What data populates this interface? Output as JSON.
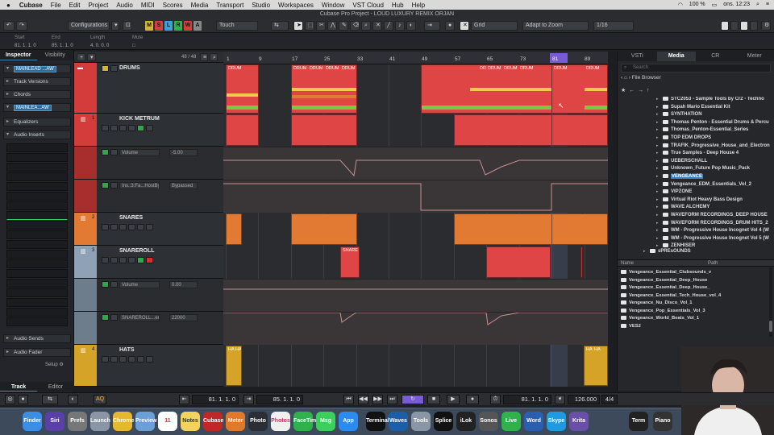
{
  "menubar": {
    "app": "Cubase",
    "items": [
      "File",
      "Edit",
      "Project",
      "Audio",
      "MIDI",
      "Scores",
      "Media",
      "Transport",
      "Studio",
      "Workspaces",
      "Window",
      "VST Cloud",
      "Hub",
      "Help"
    ],
    "battery": "100 %",
    "clock": "ons. 12:23"
  },
  "window_title": "Cubase Pro Project - LOUD LUXURY REMIX ORJAN",
  "toolbar": {
    "configurations": "Configurations",
    "mode_buttons": [
      "M",
      "S",
      "L",
      "R",
      "W",
      "A"
    ],
    "touch": "Touch",
    "grid": "Grid",
    "adapt": "Adapt to Zoom",
    "quantize": "1/16"
  },
  "infoline": {
    "labels": [
      "Start",
      "End",
      "Length",
      "Mute"
    ],
    "values": [
      "81. 1. 1.  0",
      "85. 1. 1.  0",
      "4. 0. 0.  0",
      "□"
    ]
  },
  "inspector": {
    "tabs": [
      "Inspector",
      "Visibility"
    ],
    "track_name": "MAINLEAD ...AW",
    "rows": [
      "Track Versions",
      "Chords",
      "Equalizers",
      "Audio Inserts"
    ],
    "track_name2": "MAINLEA...AW",
    "bottom_rows": [
      "Audio Sends",
      "Audio Fader"
    ],
    "setup": "Setup",
    "bottom_tabs": [
      "Track",
      "Editor"
    ]
  },
  "tracklist": {
    "count": "48 / 48",
    "tracks": [
      {
        "name": "DRUMS",
        "color": "#d43b3b",
        "num": ""
      },
      {
        "name": "KICK METRUM",
        "color": "#d43b3b",
        "num": "1"
      },
      {
        "name": "SNARES",
        "color": "#e27a34",
        "num": "2"
      },
      {
        "name": "SNAREROLL",
        "color": "#8fa1b5",
        "num": "3"
      },
      {
        "name": "HATS",
        "color": "#d4a327",
        "num": "4"
      }
    ],
    "lanes": [
      {
        "label": "Volume",
        "value": "-5.00"
      },
      {
        "label": "Ins.:3:Fa...HostBypass",
        "value": "Bypassed"
      },
      {
        "label": "Volume",
        "value": "0.00"
      },
      {
        "label": "SNAREROLL...erCutoff",
        "value": "22000"
      }
    ]
  },
  "ruler": {
    "bars": [
      "1",
      "9",
      "17",
      "25",
      "33",
      "41",
      "49",
      "57",
      "65",
      "73",
      "81",
      "89"
    ]
  },
  "events": {
    "drum_label": "DRUM",
    "dr_label": "DR",
    "snare_label": "SNARE",
    "hat_label": "HA"
  },
  "mediabay": {
    "tabs": [
      "VSTi",
      "Media",
      "CR",
      "Meter"
    ],
    "search_placeholder": "Search",
    "file_browser": "File Browser",
    "folders": [
      "STC2053 - Sample Tools by Cr2 - Techno",
      "Supah Mario Essential Kit",
      "SYNTHATION",
      "Thomas Penton - Essential Drums & Percu",
      "Thomas_Penton-Essential_Series",
      "TOP EDM DROPS",
      "TRAFIK_Progressive_House_and_Electron",
      "True Samples - Deep House 4",
      "UEBERSCHALL",
      "Unknown_Future Pop Music_Pack",
      "VENGEANCE",
      "Vengeance_EDM_Essentials_Vol_2",
      "VIPZONE",
      "Virtual Riot Heavy Bass Design",
      "WAVE ALCHEMY",
      "WAVEFORM RECORDINGS_DEEP HOUSE",
      "WAVEFORM RECORDINGS_DRUM HITS_2",
      "WM - Progressive House Incognet Vol 4 (W",
      "WM - Progressive House Incognet Vol 5 (W",
      "ZENHISER"
    ],
    "parent_folder": "sPREsOUNDS",
    "result_headers": [
      "Name",
      "Path"
    ],
    "results": [
      "Vengeance_Essential_Clubsounds_v",
      "Vengeance_Essential_Deep_House",
      "Vengeance_Essential_Deep_House_",
      "Vengeance_Essential_Tech_House_vol_4",
      "Vengeance_Nu_Disco_Vol_1",
      "Vengeance_Pop_Essentials_Vol_3",
      "Vengeance_World_Beats_Vol_1",
      "VES2"
    ]
  },
  "transport": {
    "left_locator": "81. 1. 1.  0",
    "right_locator": "85. 1. 1.  0",
    "position": "81. 1. 1.  0",
    "tempo": "126.000",
    "signature": "4/4",
    "aq": "AQ"
  },
  "dock": {
    "apps": [
      "Finder",
      "Siri",
      "Prefs",
      "Launch",
      "Chrome",
      "Preview",
      "Cal",
      "Notes",
      "Cubase",
      "Meter",
      "Photo",
      "Photos",
      "FaceTime",
      "Msg",
      "App Store",
      "Terminal",
      "Waves",
      "Tools",
      "Splice",
      "iLok",
      "Sonos",
      "Live",
      "Word",
      "Skype",
      "Krita",
      "Term",
      "Piano"
    ],
    "calendar_day": "11"
  }
}
